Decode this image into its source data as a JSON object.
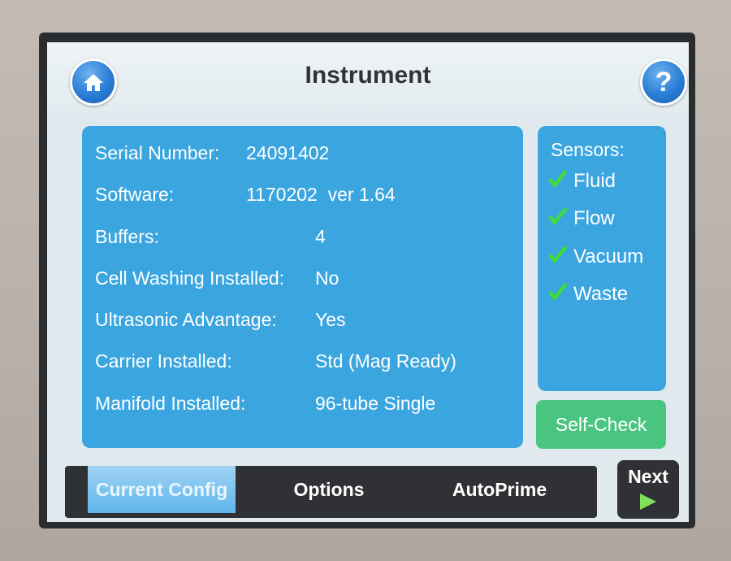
{
  "header": {
    "title": "Instrument",
    "home_icon": "home-icon",
    "help_label": "?"
  },
  "config": {
    "rows": [
      {
        "label": "Serial Number:",
        "value": "24091402"
      },
      {
        "label": "Software:",
        "value": "1170202  ver 1.64"
      },
      {
        "label": "Buffers:",
        "value": "4"
      },
      {
        "label": "Cell Washing Installed:",
        "value": "No"
      },
      {
        "label": "Ultrasonic Advantage:",
        "value": "Yes"
      },
      {
        "label": "Carrier Installed:",
        "value": "Std (Mag Ready)"
      },
      {
        "label": "Manifold Installed:",
        "value": "96-tube Single"
      }
    ]
  },
  "sensors": {
    "title": "Sensors:",
    "items": [
      {
        "name": "Fluid",
        "status": "ok"
      },
      {
        "name": "Flow",
        "status": "ok"
      },
      {
        "name": "Vacuum",
        "status": "ok"
      },
      {
        "name": "Waste",
        "status": "ok"
      }
    ],
    "check_color": "#3fdc3a"
  },
  "actions": {
    "self_check_label": "Self-Check",
    "next_label": "Next"
  },
  "tabs": [
    {
      "label": "Current Config",
      "active": true
    },
    {
      "label": "Options",
      "active": false
    },
    {
      "label": "AutoPrime",
      "active": false
    }
  ],
  "colors": {
    "panel": "#3aa5df",
    "self_check": "#49c57f",
    "tab_active": "#5fb6ec",
    "tabbar": "#2f3134"
  }
}
